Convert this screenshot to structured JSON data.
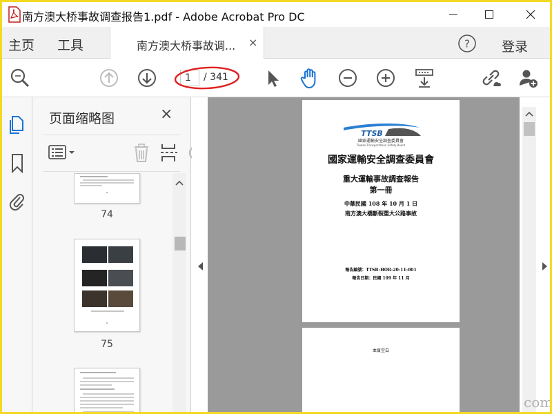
{
  "window": {
    "title": "南方澳大桥事故调查报告1.pdf - Adobe Acrobat Pro DC",
    "app_icon": "acrobat-pdf-icon",
    "controls": [
      "minimize-icon",
      "maximize-icon",
      "close-icon"
    ]
  },
  "menu": {
    "home": "主页",
    "tools": "工具",
    "doc_tab": "南方澳大桥事故调...",
    "doc_tab_close": "×",
    "login": "登录"
  },
  "toolbar": {
    "current_page": "1",
    "total_pages": "/ 341",
    "highlight_color": "#e02020",
    "icons": [
      "zoom-search-icon",
      "previous-page-icon",
      "next-page-icon",
      "select-arrow-icon",
      "hand-tool-icon",
      "zoom-out-icon",
      "zoom-in-icon",
      "scroll-mode-icon",
      "link-share-icon",
      "add-user-icon",
      "help-icon"
    ]
  },
  "rail": {
    "icons": [
      "page-thumbnails-icon",
      "bookmark-icon",
      "attachment-icon"
    ]
  },
  "thumbnails_panel": {
    "title": "页面缩略图",
    "close": "×",
    "tools": [
      "options-menu-icon",
      "delete-icon",
      "insert-page-icon",
      "rotate-icon"
    ],
    "pages": [
      {
        "number": "74"
      },
      {
        "number": "75"
      },
      {
        "number": ""
      }
    ]
  },
  "document": {
    "page1": {
      "logo_text": "TTSB",
      "logo_subtitle": "國家運輸安全調查委員會",
      "logo_en": "Taiwan Transportation Safety Board",
      "org": "國家運輸安全調查委員會",
      "report_title": "重大運輸事故調查報告",
      "volume": "第一冊",
      "date": "中華民國 108 年 10 月 1 日",
      "event": "南方澳大橋斷裂重大公路事故",
      "report_no": "報告編號：TTSB-HOR-20-11-001",
      "report_date": "報告日期：民國 109 年 11 月"
    },
    "page2": {
      "text": "本頁空白"
    },
    "accent": "#2b7fd4"
  },
  "watermark": "com"
}
